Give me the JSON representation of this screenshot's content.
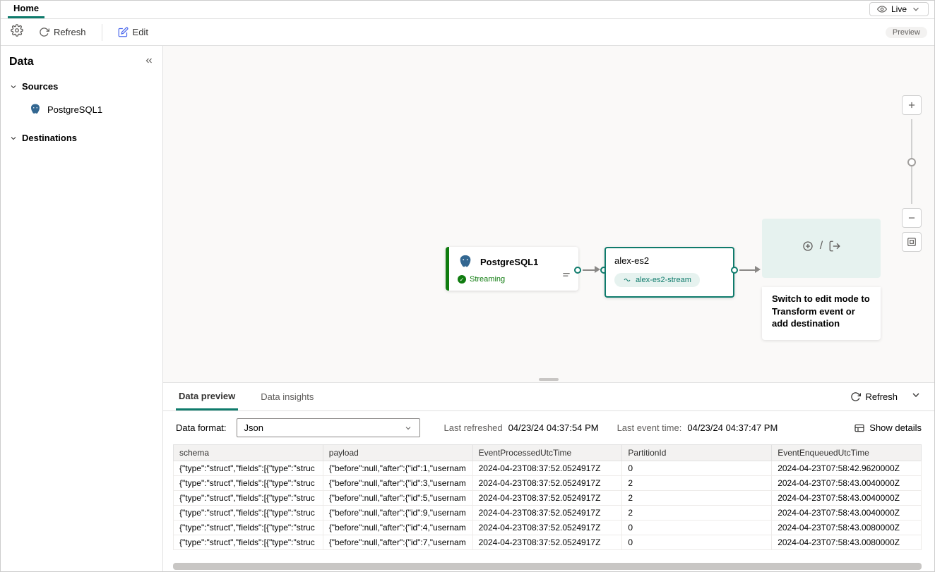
{
  "tabs": {
    "home": "Home"
  },
  "live_button": "Live",
  "toolbar": {
    "refresh": "Refresh",
    "edit": "Edit",
    "preview_badge": "Preview"
  },
  "sidebar": {
    "title": "Data",
    "sources_label": "Sources",
    "sources": [
      {
        "label": "PostgreSQL1"
      }
    ],
    "destinations_label": "Destinations"
  },
  "canvas": {
    "source_node": {
      "title": "PostgreSQL1",
      "status": "Streaming"
    },
    "stream_node": {
      "title": "alex-es2",
      "badge": "alex-es2-stream"
    },
    "dest_hint": "Switch to edit mode to Transform event or add destination"
  },
  "bottom_panel": {
    "tabs": {
      "preview": "Data preview",
      "insights": "Data insights"
    },
    "refresh": "Refresh",
    "format_label": "Data format:",
    "format_value": "Json",
    "last_refreshed_label": "Last refreshed",
    "last_refreshed_value": "04/23/24 04:37:54 PM",
    "last_event_label": "Last event time:",
    "last_event_value": "04/23/24 04:37:47 PM",
    "show_details": "Show details",
    "columns": [
      "schema",
      "payload",
      "EventProcessedUtcTime",
      "PartitionId",
      "EventEnqueuedUtcTime"
    ],
    "rows": [
      {
        "schema": "{\"type\":\"struct\",\"fields\":[{\"type\":\"struc",
        "payload": "{\"before\":null,\"after\":{\"id\":1,\"usernam",
        "processed": "2024-04-23T08:37:52.0524917Z",
        "partition": "0",
        "enqueued": "2024-04-23T07:58:42.9620000Z"
      },
      {
        "schema": "{\"type\":\"struct\",\"fields\":[{\"type\":\"struc",
        "payload": "{\"before\":null,\"after\":{\"id\":3,\"usernam",
        "processed": "2024-04-23T08:37:52.0524917Z",
        "partition": "2",
        "enqueued": "2024-04-23T07:58:43.0040000Z"
      },
      {
        "schema": "{\"type\":\"struct\",\"fields\":[{\"type\":\"struc",
        "payload": "{\"before\":null,\"after\":{\"id\":5,\"usernam",
        "processed": "2024-04-23T08:37:52.0524917Z",
        "partition": "2",
        "enqueued": "2024-04-23T07:58:43.0040000Z"
      },
      {
        "schema": "{\"type\":\"struct\",\"fields\":[{\"type\":\"struc",
        "payload": "{\"before\":null,\"after\":{\"id\":9,\"usernam",
        "processed": "2024-04-23T08:37:52.0524917Z",
        "partition": "2",
        "enqueued": "2024-04-23T07:58:43.0040000Z"
      },
      {
        "schema": "{\"type\":\"struct\",\"fields\":[{\"type\":\"struc",
        "payload": "{\"before\":null,\"after\":{\"id\":4,\"usernam",
        "processed": "2024-04-23T08:37:52.0524917Z",
        "partition": "0",
        "enqueued": "2024-04-23T07:58:43.0080000Z"
      },
      {
        "schema": "{\"type\":\"struct\",\"fields\":[{\"type\":\"struc",
        "payload": "{\"before\":null,\"after\":{\"id\":7,\"usernam",
        "processed": "2024-04-23T08:37:52.0524917Z",
        "partition": "0",
        "enqueued": "2024-04-23T07:58:43.0080000Z"
      }
    ]
  }
}
